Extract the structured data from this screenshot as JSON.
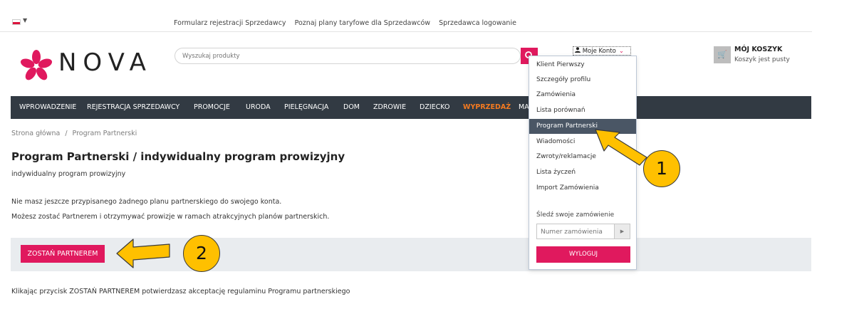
{
  "topbar": {
    "language_flag": "pl-flag-icon",
    "links": [
      "Formularz rejestracji Sprzedawcy",
      "Poznaj plany taryfowe dla Sprzedawców",
      "Sprzedawca logowanie"
    ]
  },
  "header": {
    "logo_text": "NOVA",
    "logo_icon": "flower-logo-icon",
    "search_placeholder": "Wyszukaj produkty",
    "account_label": "Moje Konto",
    "cart_title": "MÓJ KOSZYK",
    "cart_status": "Koszyk jest pusty"
  },
  "nav": {
    "items": [
      "WPROWADZENIE",
      "REJESTRACJA SPRZEDAWCY",
      "PROMOCJE",
      "URODA",
      "PIELĘGNACJA",
      "DOM",
      "ZDROWIE",
      "DZIECKO",
      "WYPRZEDAŻ",
      "MA"
    ],
    "highlight_color": "#f47a20"
  },
  "breadcrumb": {
    "home": "Strona główna",
    "separator": "/",
    "current": "Program Partnerski"
  },
  "main": {
    "title": "Program Partnerski / indywidualny program prowizyjny",
    "subtitle": "indywidualny program prowizyjny",
    "info_1": "Nie masz jeszcze przypisanego żadnego planu partnerskiego do swojego konta.",
    "info_2": "Możesz zostać Partnerem i otrzymywać prowizje w ramach atrakcyjnych planów partnerskich.",
    "become_partner_label": "ZOSTAŃ PARTNEREM",
    "footnote": "Klikając przycisk ZOSTAŃ PARTNEREM potwierdzasz akceptację regulaminu Programu partnerskiego"
  },
  "account_menu": {
    "items": [
      "Klient Pierwszy",
      "Szczegóły profilu",
      "Zamówienia",
      "Lista porównań",
      "Program Partnerski",
      "Wiadomości",
      "Zwroty/reklamacje",
      "Lista życzeń",
      "Import Zamówienia"
    ],
    "active_index": 4,
    "track_label": "Śledź swoje zamówienie",
    "order_placeholder": "Numer zamówienia",
    "logout_label": "WYLOGUJ"
  },
  "annotations": {
    "step_1": "1",
    "step_2": "2",
    "arrow_color": "#ffc000"
  },
  "colors": {
    "accent": "#e0195e",
    "nav_bg": "#323a43"
  }
}
